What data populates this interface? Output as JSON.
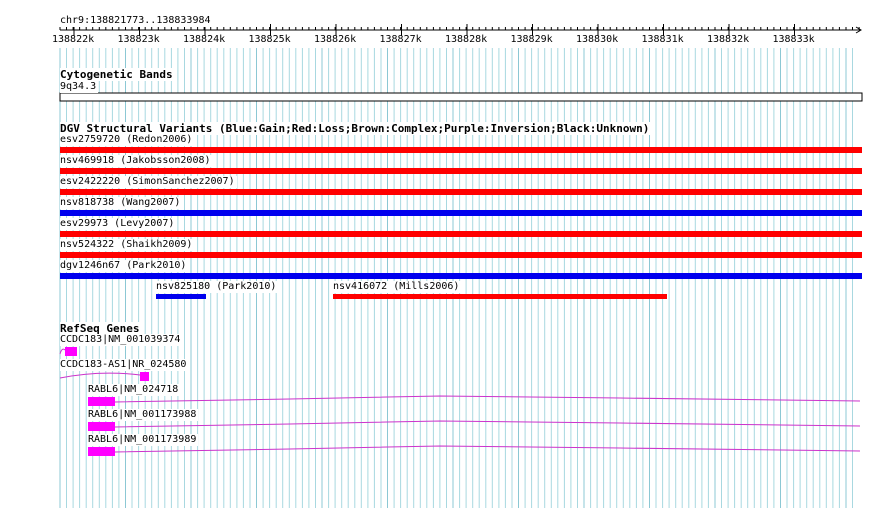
{
  "ruler": {
    "position_label": "chr9:138821773..138833984",
    "tick_labels": [
      "138822k",
      "138823k",
      "138824k",
      "138825k",
      "138826k",
      "138827k",
      "138828k",
      "138829k",
      "138830k",
      "138831k",
      "138832k",
      "138833k"
    ]
  },
  "cytoband_track": {
    "title": "Cytogenetic Bands",
    "band_label": "9q34.3"
  },
  "dgv_track": {
    "title": "DGV Structural Variants (Blue:Gain;Red:Loss;Brown:Complex;Purple:Inversion;Black:Unknown)",
    "colors": {
      "gain": "#0000ee",
      "loss": "#ff0000"
    },
    "features": [
      {
        "label": "esv2759720 (Redon2006)",
        "type": "loss"
      },
      {
        "label": "nsv469918 (Jakobsson2008)",
        "type": "loss"
      },
      {
        "label": "esv2422220 (SimonSanchez2007)",
        "type": "loss"
      },
      {
        "label": "nsv818738 (Wang2007)",
        "type": "gain"
      },
      {
        "label": "esv29973 (Levy2007)",
        "type": "loss"
      },
      {
        "label": "nsv524322 (Shaikh2009)",
        "type": "loss"
      },
      {
        "label": "dgv1246n67 (Park2010)",
        "type": "gain"
      },
      {
        "label": "nsv825180 (Park2010)",
        "type": "gain"
      },
      {
        "label": "nsv416072 (Mills2006)",
        "type": "loss"
      }
    ]
  },
  "refseq_track": {
    "title": "RefSeq Genes",
    "color": "#ff00ff",
    "intron_color": "#cc33cc",
    "genes": [
      {
        "label": "CCDC183|NM_001039374"
      },
      {
        "label": "CCDC183-AS1|NR_024580"
      },
      {
        "label": "RABL6|NM_024718"
      },
      {
        "label": "RABL6|NM_001173988"
      },
      {
        "label": "RABL6|NM_001173989"
      }
    ]
  },
  "grid_color": "#a8d8e0"
}
